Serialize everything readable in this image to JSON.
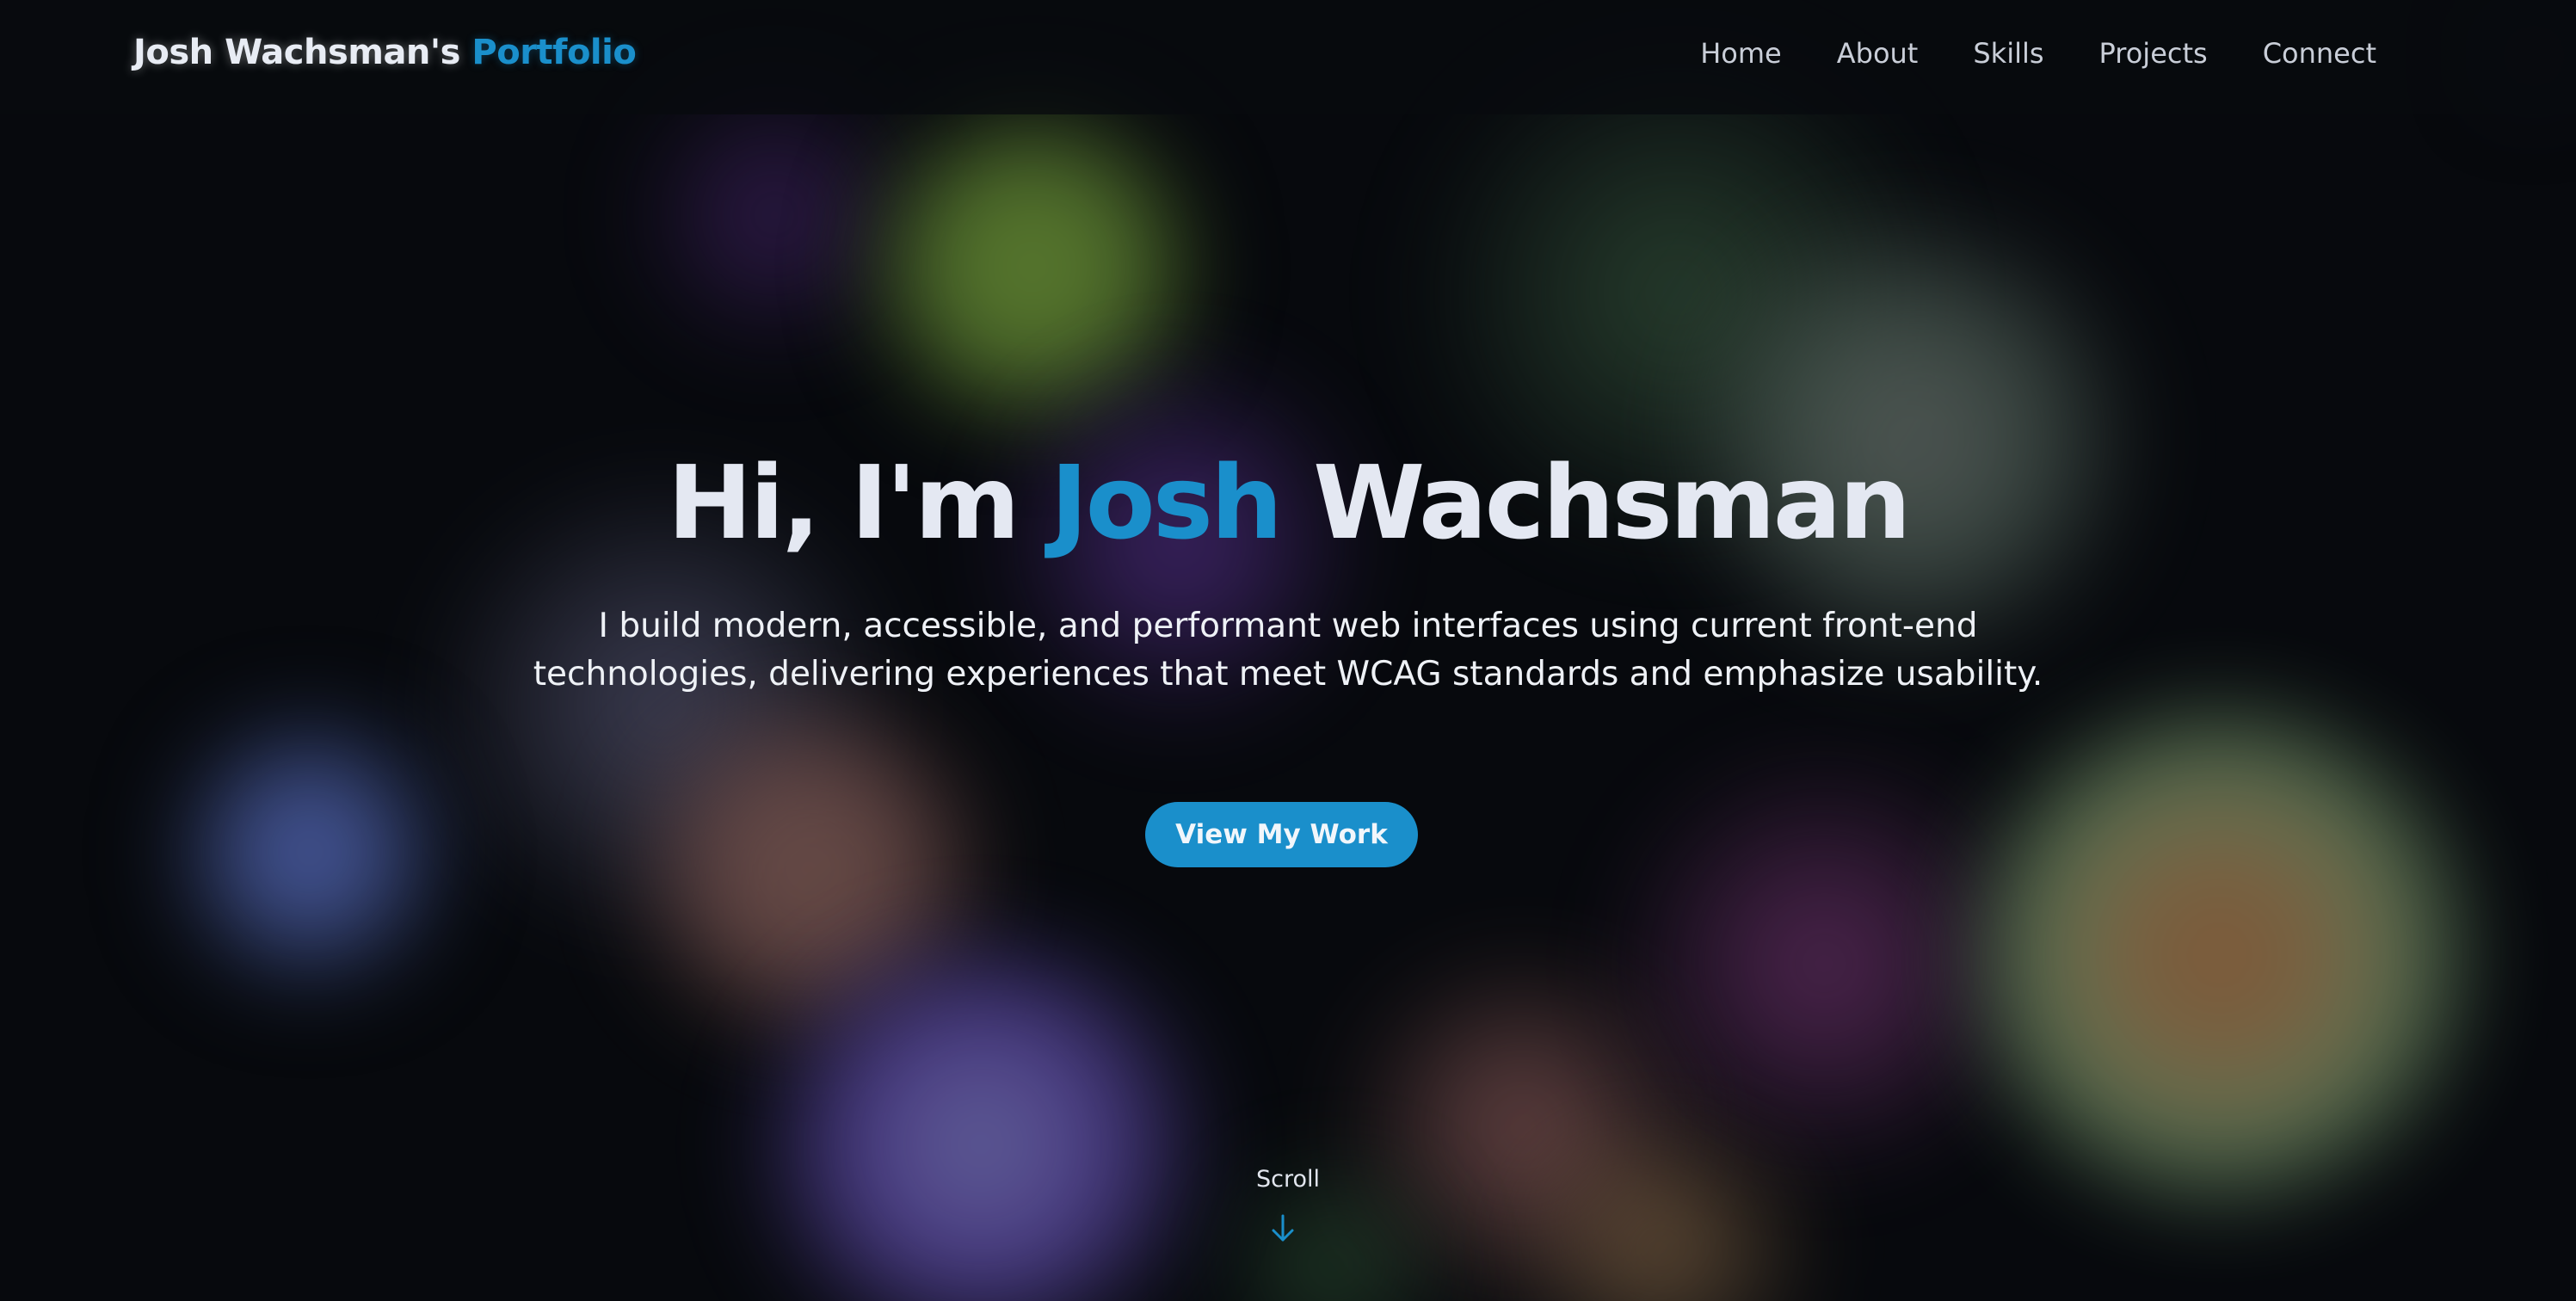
{
  "header": {
    "brand_main": "Josh Wachsman's",
    "brand_accent": "Portfolio",
    "nav": [
      "Home",
      "About",
      "Skills",
      "Projects",
      "Connect"
    ]
  },
  "hero": {
    "title_prefix": "Hi, I'm",
    "title_accent": "Josh",
    "title_suffix": "Wachsman",
    "subtitle": "I build modern, accessible, and performant web interfaces using current front-end technologies, delivering experiences that meet WCAG standards and emphasize usability.",
    "cta_label": "View My Work",
    "scroll_label": "Scroll",
    "scroll_icon": "arrow-down-icon"
  },
  "colors": {
    "accent": "#1a8fcb",
    "background": "#07090d",
    "text": "#e4e8f2"
  }
}
